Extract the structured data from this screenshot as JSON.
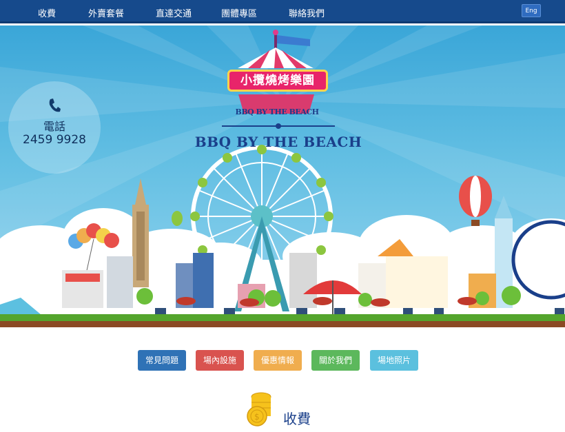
{
  "nav": {
    "items": [
      "收費",
      "外賣套餐",
      "直達交通",
      "團體專區",
      "聯絡我們"
    ],
    "lang": "Eng"
  },
  "hero": {
    "logo_chinese": "小攬燒烤樂園",
    "logo_english": "BBQ BY THE BEACH",
    "title": "BBQ BY THE BEACH",
    "phone_label": "電話",
    "phone_number": "2459 9928"
  },
  "buttons": [
    {
      "label": "常見問題",
      "color": "#2f72b6"
    },
    {
      "label": "場內設施",
      "color": "#d9534f"
    },
    {
      "label": "優惠情報",
      "color": "#f0ad4e"
    },
    {
      "label": "關於我們",
      "color": "#5cb85c"
    },
    {
      "label": "場地照片",
      "color": "#5bc0de"
    }
  ],
  "section": {
    "title": "收費",
    "icon": "coins-icon"
  },
  "colors": {
    "nav_bg": "#164a8c",
    "sky": "#63bfe3",
    "grass": "#54a52d",
    "title": "#1a3f8a"
  }
}
